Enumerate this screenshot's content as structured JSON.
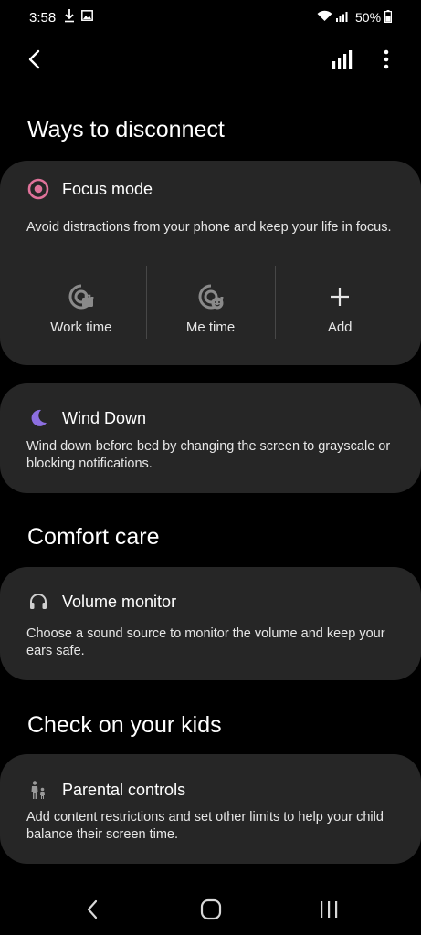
{
  "status_bar": {
    "time": "3:58",
    "battery": "50%"
  },
  "top_bar": {
    "icons": [
      "back-arrow-icon",
      "bar-chart-icon",
      "more-options-icon"
    ]
  },
  "sections": {
    "ways_to_disconnect": "Ways to disconnect",
    "comfort_care": "Comfort care",
    "check_on_kids": "Check on your kids"
  },
  "focus_mode": {
    "title": "Focus mode",
    "description": "Avoid distractions from your phone and keep your life in focus.",
    "accent": "#e0729a",
    "items": [
      {
        "label": "Work time",
        "icon": "work-time-icon"
      },
      {
        "label": "Me time",
        "icon": "me-time-icon"
      },
      {
        "label": "Add",
        "icon": "plus-icon"
      }
    ]
  },
  "wind_down": {
    "title": "Wind Down",
    "description": "Wind down before bed by changing the screen to grayscale or blocking notifications.",
    "accent": "#8c6fe0"
  },
  "volume_monitor": {
    "title": "Volume monitor",
    "description": "Choose a sound source to monitor the volume and keep your ears safe."
  },
  "parental_controls": {
    "title": "Parental controls",
    "description": "Add content restrictions and set other limits to help your child balance their screen time."
  },
  "nav_bar": {
    "icons": [
      "nav-back-icon",
      "nav-home-icon",
      "nav-recents-icon"
    ]
  }
}
